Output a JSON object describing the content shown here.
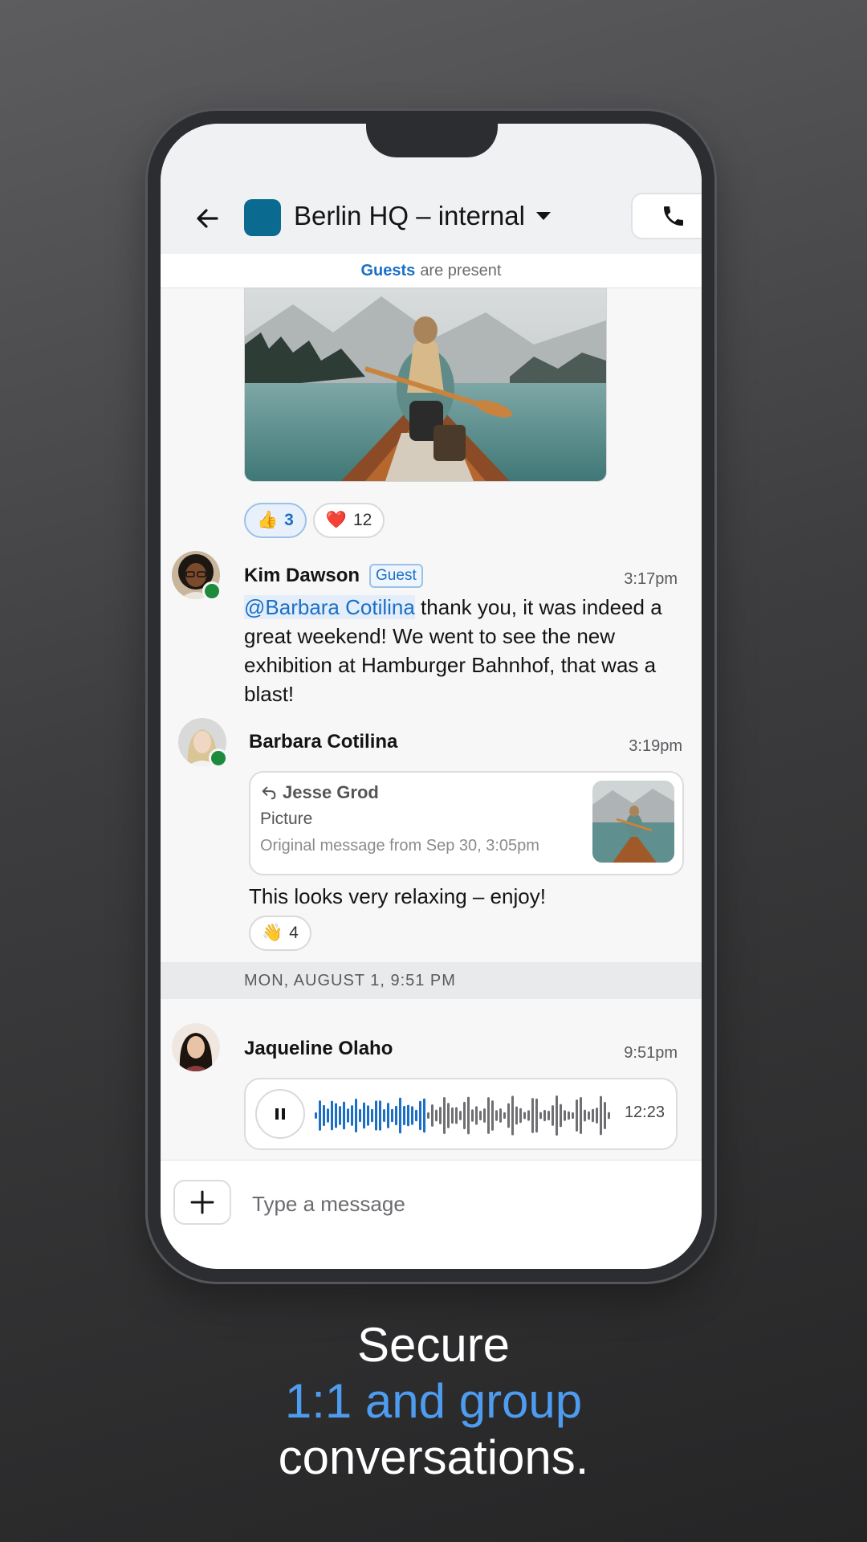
{
  "header": {
    "title": "Berlin HQ – internal",
    "group_color": "#0b6a8f"
  },
  "banner": {
    "highlight": "Guests",
    "rest": "are present"
  },
  "image_message": {
    "reactions": [
      {
        "emoji": "👍",
        "count": "3",
        "active": true
      },
      {
        "emoji": "❤️",
        "count": "12",
        "active": false
      }
    ]
  },
  "messages": [
    {
      "sender": "Kim Dawson",
      "badge": "Guest",
      "time": "3:17pm",
      "mention": "@Barbara Cotilina",
      "text": " thank you, it was indeed a great weekend! We went to see the new exhibition at Hamburger Bahnhof, that was a blast!"
    },
    {
      "sender": "Barbara Cotilina",
      "time": "3:19pm",
      "quote": {
        "author": "Jesse Grod",
        "type": "Picture",
        "original": "Original message from Sep 30, 3:05pm"
      },
      "text": "This looks very relaxing – enjoy!",
      "reaction": {
        "emoji": "👋",
        "count": "4"
      }
    }
  ],
  "date_separator": "MON, AUGUST 1, 9:51 PM",
  "voice_message": {
    "sender": "Jaqueline Olaho",
    "time": "9:51pm",
    "duration": "12:23",
    "progress": 0.37
  },
  "composer": {
    "placeholder": "Type a message"
  },
  "tagline": {
    "line1": "Secure",
    "line2": "1:1 and group",
    "line3": "conversations."
  },
  "colors": {
    "accent": "#1b6fc6",
    "online": "#1e8a3c",
    "tagline_accent": "#4e9cf0"
  }
}
